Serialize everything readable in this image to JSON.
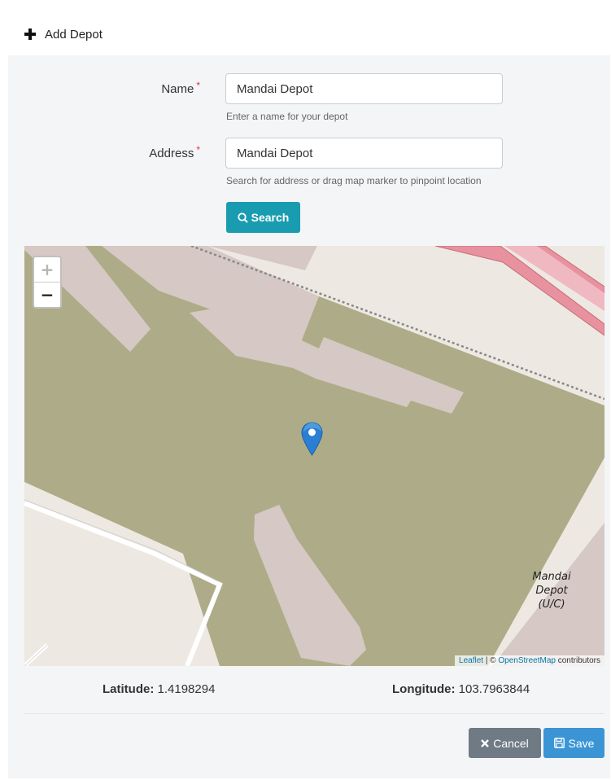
{
  "header": {
    "title": "Add Depot",
    "icon": "plus-icon"
  },
  "form": {
    "name": {
      "label": "Name",
      "required_mark": "*",
      "value": "Mandai Depot",
      "help": "Enter a name for your depot"
    },
    "address": {
      "label": "Address",
      "required_mark": "*",
      "value": "Mandai Depot",
      "help": "Search for address or drag map marker to pinpoint location"
    },
    "search_button": "Search"
  },
  "map": {
    "zoom_in": "+",
    "zoom_out": "−",
    "place_label": "Mandai\nDepot\n(U/C)",
    "attribution": {
      "leaflet": "Leaflet",
      "separator": " | © ",
      "osm": "OpenStreetMap",
      "suffix": " contributors"
    },
    "colors": {
      "land": "#aeac88",
      "buildings": "#d6c8c4",
      "background": "#ede9e2",
      "road": "#e892a0",
      "marker": "#2a7fd4"
    }
  },
  "coordinates": {
    "latitude_label": "Latitude:",
    "latitude": "1.4198294",
    "longitude_label": "Longitude:",
    "longitude": "103.7963844"
  },
  "actions": {
    "cancel": "Cancel",
    "save": "Save"
  }
}
